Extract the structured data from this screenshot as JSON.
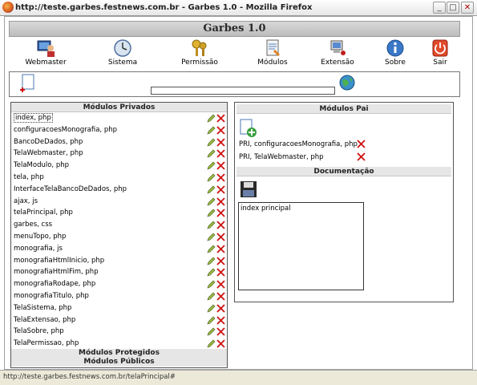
{
  "window": {
    "title": "http://teste.garbes.festnews.com.br - Garbes 1.0 - Mozilla Firefox",
    "min": "_",
    "max": "□",
    "close": "✕"
  },
  "app": {
    "title": "Garbes 1.0"
  },
  "toolbar": [
    {
      "label": "Webmaster",
      "icon": "webmaster-icon"
    },
    {
      "label": "Sistema",
      "icon": "clock-icon"
    },
    {
      "label": "Permissão",
      "icon": "keys-icon"
    },
    {
      "label": "Módulos",
      "icon": "document-icon"
    },
    {
      "label": "Extensão",
      "icon": "computer-icon"
    },
    {
      "label": "Sobre",
      "icon": "info-icon"
    },
    {
      "label": "Sair",
      "icon": "exit-icon"
    }
  ],
  "actionbar": {
    "search_value": ""
  },
  "left": {
    "header": "Módulos Privados",
    "items": [
      "index, php",
      "configuracoesMonografia, php",
      "BancoDeDados, php",
      "TelaWebmaster, php",
      "TelaModulo, php",
      "tela, php",
      "InterfaceTelaBancoDeDados, php",
      "ajax, js",
      "telaPrincipal, php",
      "garbes, css",
      "menuTopo, php",
      "monografia, js",
      "monografiaHtmlInicio, php",
      "monografiaHtmlFim, php",
      "monografiaRodape, php",
      "monografiaTitulo, php",
      "TelaSistema, php",
      "TelaExtensao, php",
      "TelaSobre, php",
      "TelaPermissao, php"
    ],
    "protegidos": "Módulos Protegidos",
    "publicos": "Módulos Públicos"
  },
  "right": {
    "pai_header": "Módulos Pai",
    "pai_items": [
      "PRI, configuracoesMonografia, php",
      "PRI, TelaWebmaster, php"
    ],
    "doc_header": "Documentação",
    "doc_text": "index principal"
  },
  "status": "http://teste.garbes.festnews.com.br/telaPrincipal#",
  "colors": {
    "delete": "#cc1111",
    "edit": "#6b8e23",
    "header_bg": "#e6e6e6"
  }
}
